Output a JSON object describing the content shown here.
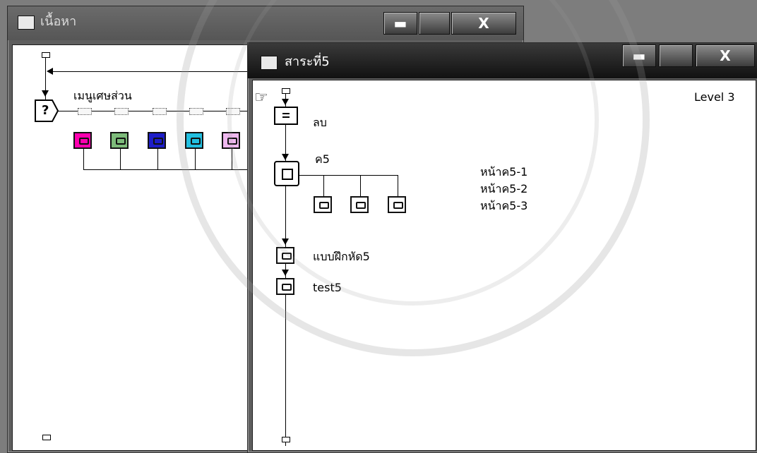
{
  "window_left": {
    "title": "เนื้อหา",
    "icon": "content-icon",
    "controls": {
      "minimize": "▬",
      "close": "X"
    },
    "flow": {
      "decision_label": "เมนูเศษส่วน",
      "decision_symbol": "?",
      "branch_colors": [
        "#ff00b0",
        "#7dbb7a",
        "#1d1dc8",
        "#22bfe0",
        "#efb8ef"
      ]
    }
  },
  "window_right": {
    "title": "สาระที่5",
    "icon": "content-icon",
    "controls": {
      "minimize": "▬",
      "close": "X"
    },
    "level": "Level 3",
    "nodes": {
      "erase": "ลบ",
      "map_label": "ค5",
      "pages": [
        "หน้าค5-1",
        "หน้าค5-2",
        "หน้าค5-3"
      ],
      "exercise": "แบบฝึกหัด5",
      "test": "test5"
    }
  }
}
